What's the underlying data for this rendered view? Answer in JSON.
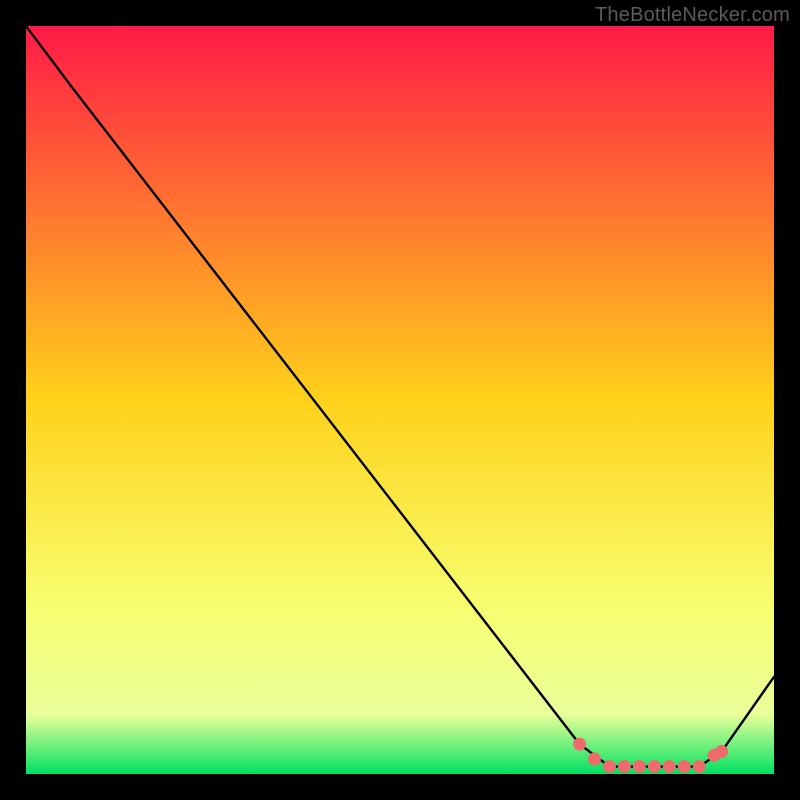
{
  "watermark": "TheBottleNecker.com",
  "colors": {
    "bg": "#000000",
    "grad_top": "#ff1a46",
    "grad_mid": "#ffd21a",
    "grad_low": "#f7ff71",
    "grad_band": "#eaff9a",
    "grad_bottom": "#00e161",
    "curve": "#000000",
    "marker": "#ef6b6b"
  },
  "chart_data": {
    "type": "line",
    "title": "",
    "xlabel": "",
    "ylabel": "",
    "xlim": [
      0,
      100
    ],
    "ylim": [
      0,
      100
    ],
    "series": [
      {
        "name": "curve",
        "x": [
          0,
          6,
          74,
          78,
          90,
          93,
          100
        ],
        "y": [
          100,
          92,
          4,
          1,
          1,
          3,
          13
        ]
      }
    ],
    "markers": {
      "name": "highlight",
      "points": [
        {
          "x": 74,
          "y": 4
        },
        {
          "x": 76,
          "y": 2
        },
        {
          "x": 78,
          "y": 1
        },
        {
          "x": 80,
          "y": 1
        },
        {
          "x": 82,
          "y": 1
        },
        {
          "x": 84,
          "y": 1
        },
        {
          "x": 86,
          "y": 1
        },
        {
          "x": 88,
          "y": 1
        },
        {
          "x": 90,
          "y": 1
        },
        {
          "x": 92,
          "y": 2.5
        },
        {
          "x": 93,
          "y": 3
        }
      ]
    }
  }
}
